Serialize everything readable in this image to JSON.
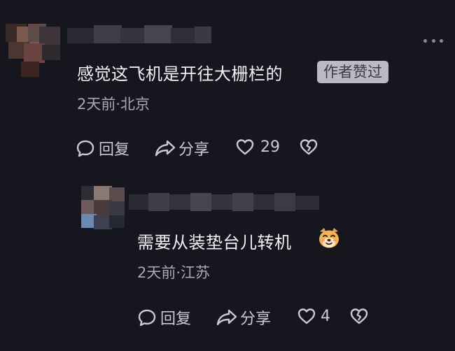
{
  "comments": [
    {
      "text": "感觉这飞机是开往大栅栏的",
      "badge": "作者赞过",
      "meta": "2天前·北京",
      "actions": {
        "reply": "回复",
        "share": "分享",
        "likes": "29"
      }
    },
    {
      "text": "需要从装垫台儿转机",
      "emoji": "dog-face-emoji",
      "meta": "2天前·江苏",
      "actions": {
        "reply": "回复",
        "share": "分享",
        "likes": "4"
      }
    }
  ],
  "icons": {
    "more": "more-dots-icon",
    "reply": "speech-bubble-icon",
    "share": "share-arrow-icon",
    "like": "heart-icon",
    "dislike": "broken-heart-icon"
  },
  "colors": {
    "background": "#16171e",
    "text": "#f0f0f3",
    "meta": "#a8a9b0",
    "badge_bg": "#b9bac2",
    "badge_text": "#3a3b44"
  }
}
